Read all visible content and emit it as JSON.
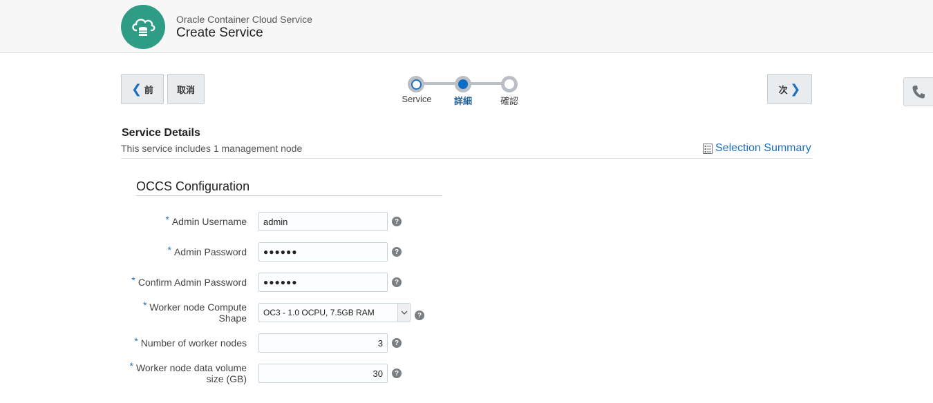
{
  "header": {
    "subtitle": "Oracle Container Cloud Service",
    "title": "Create Service",
    "logo_icon": "cloud-database-icon"
  },
  "nav": {
    "prev_label": "前",
    "cancel_label": "取消",
    "next_label": "次"
  },
  "train": {
    "steps": [
      {
        "label": "Service",
        "state": "visited"
      },
      {
        "label": "詳細",
        "state": "current"
      },
      {
        "label": "確認",
        "state": "unvisited"
      }
    ]
  },
  "section": {
    "title": "Service Details",
    "description": "This service includes 1 management node",
    "summary_link": "Selection Summary"
  },
  "config": {
    "title": "OCCS Configuration",
    "required_marker": "*",
    "fields": [
      {
        "label": "Admin Username",
        "value": "admin",
        "type": "text"
      },
      {
        "label": "Admin Password",
        "value": "●●●●●●",
        "type": "password"
      },
      {
        "label": "Confirm Admin Password",
        "value": "●●●●●●",
        "type": "password"
      },
      {
        "label_line1": "Worker node Compute",
        "label_line2": "Shape",
        "value": "OC3 - 1.0 OCPU, 7.5GB RAM",
        "type": "select"
      },
      {
        "label": "Number of worker nodes",
        "value": "3",
        "type": "number"
      },
      {
        "label_line1": "Worker node data volume",
        "label_line2": "size (GB)",
        "value": "30",
        "type": "number"
      }
    ],
    "help_glyph": "?"
  },
  "colors": {
    "accent": "#1f6fbf",
    "logo_bg": "#2f9c85",
    "header_bg": "#f7f7f7"
  }
}
